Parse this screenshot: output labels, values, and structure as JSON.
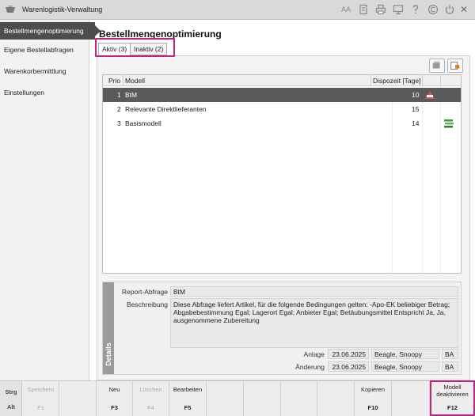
{
  "window": {
    "title": "Warenlogistik-Verwaltung",
    "icons": [
      "text-size-icon",
      "document-icon",
      "print-icon",
      "monitor-icon",
      "help-icon",
      "copyright-icon",
      "power-icon",
      "close-icon"
    ],
    "text_size_glyph": "AA",
    "close_glyph": "✕"
  },
  "sidebar": {
    "items": [
      {
        "label": "Bestellmengenoptimierung",
        "active": true
      },
      {
        "label": "Eigene Bestellabfragen",
        "active": false
      },
      {
        "label": "Warenkorbermittlung",
        "active": false
      },
      {
        "label": "Einstellungen",
        "active": false
      }
    ]
  },
  "main": {
    "title": "Bestellmengenoptimierung",
    "tabs": [
      {
        "label": "Aktiv (3)",
        "active": true
      },
      {
        "label": "Inaktiv (2)",
        "active": false
      }
    ]
  },
  "table": {
    "headers": {
      "prio": "Prio",
      "model": "Modell",
      "disposition": "Dispozeit [Tage]"
    },
    "rows": [
      {
        "prio": "1",
        "model": "BtM",
        "days": "10",
        "icon": "btm-warning-icon",
        "selected": true
      },
      {
        "prio": "2",
        "model": "Relevante Direktlieferanten",
        "days": "15",
        "icon": "",
        "selected": false
      },
      {
        "prio": "3",
        "model": "Basismodell",
        "days": "14",
        "icon": "stack-green-icon",
        "selected": false
      }
    ]
  },
  "details": {
    "strip_label": "Details",
    "report_label": "Report-Abfrage",
    "report_value": "BtM",
    "desc_label": "Beschreibung",
    "desc_value": "Diese Abfrage liefert Artikel, für die folgende Bedingungen gelten: -Apo-EK beliebiger Betrag; Abgabebestimmung Egal; Lagerort Egal; Anbieter Egal; Betäubungsmittel Entspricht Ja, Ja, ausgenommene Zubereitung",
    "created_label": "Anlage",
    "created_date": "23.06.2025",
    "created_user": "Beagle, Snoopy",
    "created_code": "BA",
    "changed_label": "Änderung",
    "changed_date": "23.06.2025",
    "changed_user": "Beagle, Snoopy",
    "changed_code": "BA"
  },
  "fkeys": {
    "mod_strg": "Strg",
    "mod_alt": "Alt",
    "keys": [
      {
        "label": "Speichern",
        "key": "F1",
        "enabled": false
      },
      {
        "label": "",
        "key": "",
        "enabled": false
      },
      {
        "label": "",
        "key": "",
        "enabled": false
      },
      {
        "label": "Neu",
        "key": "F3",
        "enabled": true
      },
      {
        "label": "Löschen",
        "key": "F4",
        "enabled": false
      },
      {
        "label": "Bearbeiten",
        "key": "F5",
        "enabled": true
      },
      {
        "label": "",
        "key": "",
        "enabled": false
      },
      {
        "label": "",
        "key": "",
        "enabled": false
      },
      {
        "label": "",
        "key": "",
        "enabled": false
      },
      {
        "label": "Kopieren",
        "key": "F10",
        "enabled": true
      },
      {
        "label": "",
        "key": "",
        "enabled": false
      },
      {
        "label": "Modell deaktivieren",
        "key": "F12",
        "enabled": true
      }
    ]
  },
  "colors": {
    "highlight": "#c0237e",
    "selected_row": "#5a5a5a",
    "sidebar_active": "#4d4d4d"
  }
}
